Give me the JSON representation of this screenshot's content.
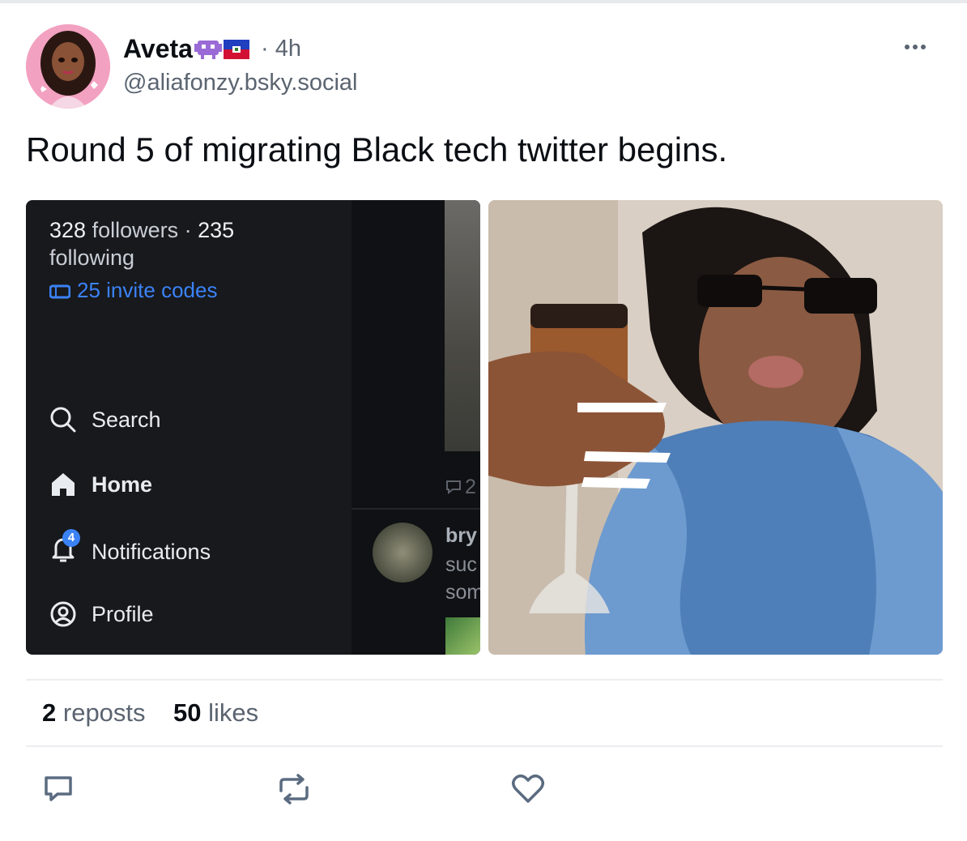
{
  "post": {
    "author_name": "Aveta",
    "time": "· 4h",
    "handle": "@aliafonzy.bsky.social",
    "text": "Round 5 of migrating Black tech twitter begins.",
    "more_label": "•••"
  },
  "screenshot": {
    "followers_count": "328",
    "followers_label": " followers · ",
    "following_count": "235",
    "following_label": "following",
    "invite_codes": "25 invite codes",
    "nav": {
      "search": "Search",
      "home": "Home",
      "notifications": "Notifications",
      "notifications_badge": "4",
      "profile": "Profile"
    },
    "feed": {
      "reply_count": "2",
      "line1": "bry",
      "line2": "suc",
      "line3": "som"
    }
  },
  "counts": {
    "reposts_num": "2",
    "reposts_label": "reposts",
    "likes_num": "50",
    "likes_label": "likes"
  },
  "icons": {
    "reply": "reply-icon",
    "repost": "repost-icon",
    "like": "heart-icon"
  },
  "colors": {
    "accent": "#3b82f6",
    "action_icon": "#5b6b80"
  }
}
